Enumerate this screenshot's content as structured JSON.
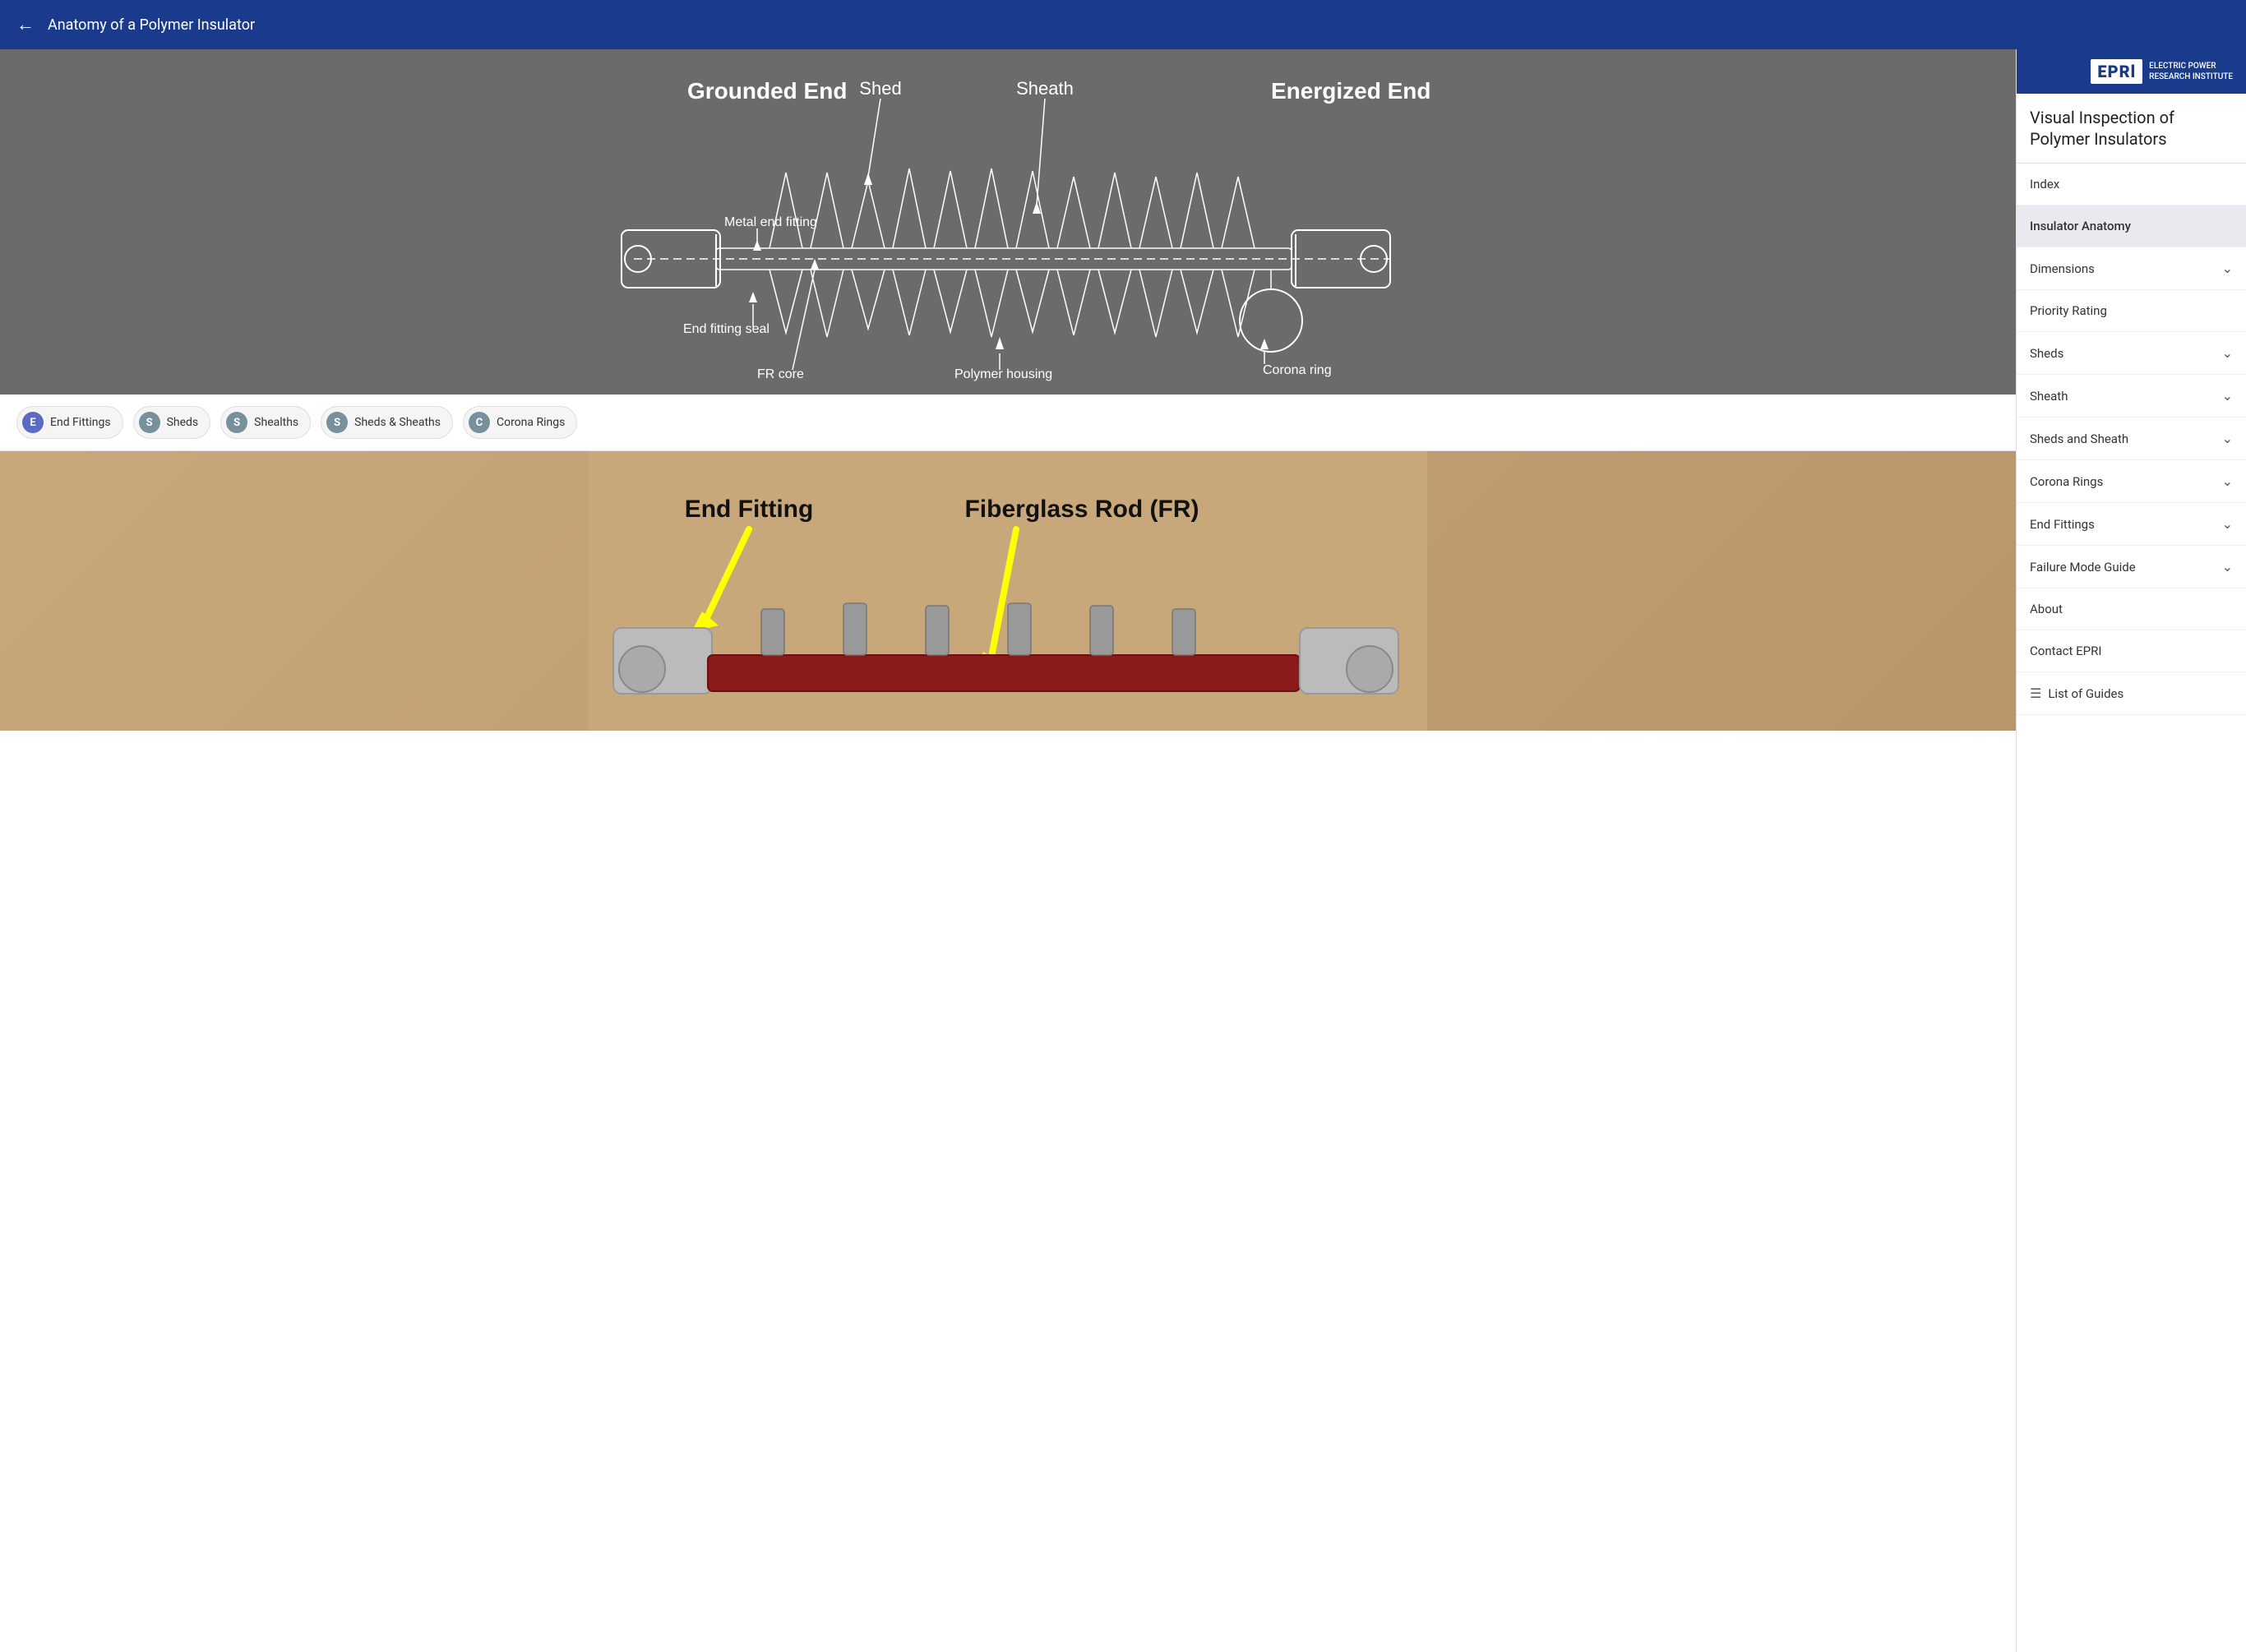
{
  "topbar": {
    "title": "Anatomy of a Polymer Insulator",
    "back_label": "←"
  },
  "sidebar": {
    "logo_text": "EPRl",
    "logo_subtitle": "ELECTRIC POWER\nRESEARCH INSTITUTE",
    "title": "Visual Inspection of Polymer Insulators",
    "nav_items": [
      {
        "id": "index",
        "label": "Index",
        "has_chevron": false,
        "active": false
      },
      {
        "id": "insulator-anatomy",
        "label": "Insulator Anatomy",
        "has_chevron": false,
        "active": true
      },
      {
        "id": "dimensions",
        "label": "Dimensions",
        "has_chevron": true,
        "active": false
      },
      {
        "id": "priority-rating",
        "label": "Priority Rating",
        "has_chevron": false,
        "active": false
      },
      {
        "id": "sheds",
        "label": "Sheds",
        "has_chevron": true,
        "active": false
      },
      {
        "id": "sheath",
        "label": "Sheath",
        "has_chevron": true,
        "active": false
      },
      {
        "id": "sheds-and-sheath",
        "label": "Sheds and Sheath",
        "has_chevron": true,
        "active": false
      },
      {
        "id": "corona-rings",
        "label": "Corona Rings",
        "has_chevron": true,
        "active": false
      },
      {
        "id": "end-fittings",
        "label": "End Fittings",
        "has_chevron": true,
        "active": false
      },
      {
        "id": "failure-mode-guide",
        "label": "Failure Mode Guide",
        "has_chevron": true,
        "active": false
      },
      {
        "id": "about",
        "label": "About",
        "has_chevron": false,
        "active": false
      },
      {
        "id": "contact-epri",
        "label": "Contact EPRI",
        "has_chevron": false,
        "active": false
      },
      {
        "id": "list-of-guides",
        "label": "List of Guides",
        "has_chevron": false,
        "active": false,
        "has_list_icon": true
      }
    ]
  },
  "diagram": {
    "grounded_end": "Grounded End",
    "energized_end": "Energized End",
    "shed_label": "Shed",
    "sheath_label": "Sheath",
    "metal_end_fitting": "Metal end fitting",
    "end_fitting_seal": "End fitting seal",
    "fr_core": "FR core",
    "polymer_housing": "Polymer housing",
    "corona_ring": "Corona ring"
  },
  "chips": [
    {
      "id": "end-fittings",
      "avatar": "E",
      "label": "End Fittings",
      "color": "#5c6bc0"
    },
    {
      "id": "sheds",
      "avatar": "S",
      "label": "Sheds",
      "color": "#78909c"
    },
    {
      "id": "shealths",
      "avatar": "S",
      "label": "Shealths",
      "color": "#78909c"
    },
    {
      "id": "sheds-sheaths",
      "avatar": "S",
      "label": "Sheds & Sheaths",
      "color": "#78909c"
    },
    {
      "id": "corona-rings",
      "avatar": "C",
      "label": "Corona Rings",
      "color": "#78909c"
    }
  ],
  "photo": {
    "end_fitting_label": "End Fitting",
    "fiberglass_rod_label": "Fiberglass Rod (FR)"
  }
}
